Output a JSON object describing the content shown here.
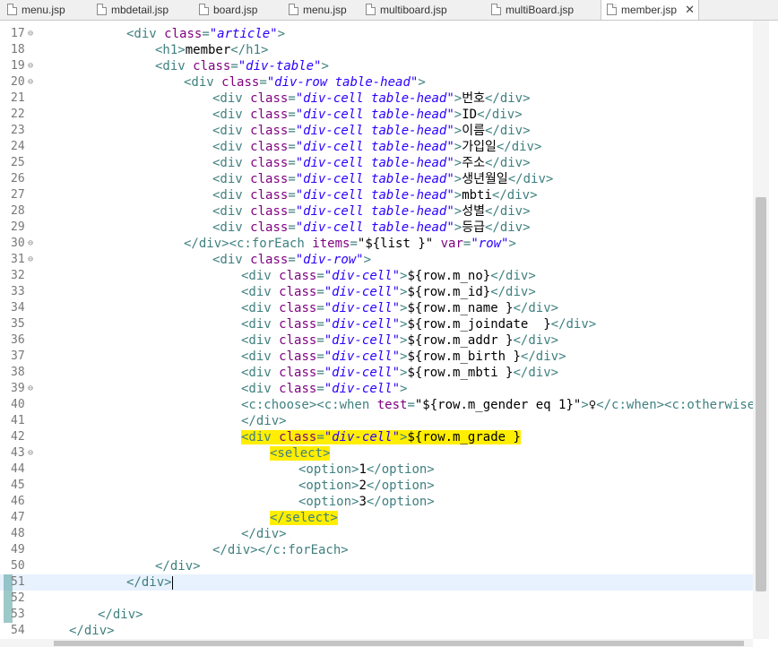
{
  "tabs": [
    {
      "label": "menu.jsp",
      "active": false
    },
    {
      "label": "mbdetail.jsp",
      "active": false
    },
    {
      "label": "board.jsp",
      "active": false
    },
    {
      "label": "menu.jsp",
      "active": false
    },
    {
      "label": "multiboard.jsp",
      "active": false
    },
    {
      "label": "multiBoard.jsp",
      "active": false
    },
    {
      "label": "member.jsp",
      "active": true
    }
  ],
  "close_icon": "✕",
  "fold_icon": "⊖",
  "colors": {
    "tag": "#3f7f7f",
    "attribute": "#7f007f",
    "value": "#2a00ff",
    "highlight": "#ffee00"
  },
  "lines": [
    {
      "n": "17",
      "fold": true,
      "segs": [
        [
          "t",
          "<div "
        ],
        [
          "a",
          "class"
        ],
        [
          "t",
          "="
        ],
        [
          "v",
          "\"article\""
        ],
        [
          "t",
          ">"
        ]
      ]
    },
    {
      "n": "18",
      "segs": [
        [
          "t",
          "<h1>"
        ],
        [
          "x",
          "member"
        ],
        [
          "t",
          "</h1>"
        ]
      ]
    },
    {
      "n": "19",
      "fold": true,
      "segs": [
        [
          "t",
          "<div "
        ],
        [
          "a",
          "class"
        ],
        [
          "t",
          "="
        ],
        [
          "v",
          "\"div-table\""
        ],
        [
          "t",
          ">"
        ]
      ]
    },
    {
      "n": "20",
      "fold": true,
      "segs": [
        [
          "t",
          "<div "
        ],
        [
          "a",
          "class"
        ],
        [
          "t",
          "="
        ],
        [
          "v",
          "\"div-row table-head\""
        ],
        [
          "t",
          ">"
        ]
      ]
    },
    {
      "n": "21",
      "segs": [
        [
          "t",
          "<div "
        ],
        [
          "a",
          "class"
        ],
        [
          "t",
          "="
        ],
        [
          "v",
          "\"div-cell table-head\""
        ],
        [
          "t",
          ">"
        ],
        [
          "x",
          "번호"
        ],
        [
          "t",
          "</div>"
        ]
      ]
    },
    {
      "n": "22",
      "segs": [
        [
          "t",
          "<div "
        ],
        [
          "a",
          "class"
        ],
        [
          "t",
          "="
        ],
        [
          "v",
          "\"div-cell table-head\""
        ],
        [
          "t",
          ">"
        ],
        [
          "x",
          "ID"
        ],
        [
          "t",
          "</div>"
        ]
      ]
    },
    {
      "n": "23",
      "segs": [
        [
          "t",
          "<div "
        ],
        [
          "a",
          "class"
        ],
        [
          "t",
          "="
        ],
        [
          "v",
          "\"div-cell table-head\""
        ],
        [
          "t",
          ">"
        ],
        [
          "x",
          "이름"
        ],
        [
          "t",
          "</div>"
        ]
      ]
    },
    {
      "n": "24",
      "segs": [
        [
          "t",
          "<div "
        ],
        [
          "a",
          "class"
        ],
        [
          "t",
          "="
        ],
        [
          "v",
          "\"div-cell table-head\""
        ],
        [
          "t",
          ">"
        ],
        [
          "x",
          "가입일"
        ],
        [
          "t",
          "</div>"
        ]
      ]
    },
    {
      "n": "25",
      "segs": [
        [
          "t",
          "<div "
        ],
        [
          "a",
          "class"
        ],
        [
          "t",
          "="
        ],
        [
          "v",
          "\"div-cell table-head\""
        ],
        [
          "t",
          ">"
        ],
        [
          "x",
          "주소"
        ],
        [
          "t",
          "</div>"
        ]
      ]
    },
    {
      "n": "26",
      "segs": [
        [
          "t",
          "<div "
        ],
        [
          "a",
          "class"
        ],
        [
          "t",
          "="
        ],
        [
          "v",
          "\"div-cell table-head\""
        ],
        [
          "t",
          ">"
        ],
        [
          "x",
          "생년월일"
        ],
        [
          "t",
          "</div>"
        ]
      ]
    },
    {
      "n": "27",
      "segs": [
        [
          "t",
          "<div "
        ],
        [
          "a",
          "class"
        ],
        [
          "t",
          "="
        ],
        [
          "v",
          "\"div-cell table-head\""
        ],
        [
          "t",
          ">"
        ],
        [
          "x",
          "mbti"
        ],
        [
          "t",
          "</div>"
        ]
      ]
    },
    {
      "n": "28",
      "segs": [
        [
          "t",
          "<div "
        ],
        [
          "a",
          "class"
        ],
        [
          "t",
          "="
        ],
        [
          "v",
          "\"div-cell table-head\""
        ],
        [
          "t",
          ">"
        ],
        [
          "x",
          "성별"
        ],
        [
          "t",
          "</div>"
        ]
      ]
    },
    {
      "n": "29",
      "segs": [
        [
          "t",
          "<div "
        ],
        [
          "a",
          "class"
        ],
        [
          "t",
          "="
        ],
        [
          "v",
          "\"div-cell table-head\""
        ],
        [
          "t",
          ">"
        ],
        [
          "x",
          "등급"
        ],
        [
          "t",
          "</div>"
        ]
      ]
    },
    {
      "n": "30",
      "fold": true,
      "segs": [
        [
          "t",
          "</div><c:forEach "
        ],
        [
          "a",
          "items"
        ],
        [
          "t",
          "="
        ],
        [
          "x",
          "\"${list }\" "
        ],
        [
          "a",
          "var"
        ],
        [
          "t",
          "="
        ],
        [
          "v",
          "\"row\""
        ],
        [
          "t",
          ">"
        ]
      ]
    },
    {
      "n": "31",
      "fold": true,
      "segs": [
        [
          "t",
          "<div "
        ],
        [
          "a",
          "class"
        ],
        [
          "t",
          "="
        ],
        [
          "v",
          "\"div-row\""
        ],
        [
          "t",
          ">"
        ]
      ]
    },
    {
      "n": "32",
      "segs": [
        [
          "t",
          "<div "
        ],
        [
          "a",
          "class"
        ],
        [
          "t",
          "="
        ],
        [
          "v",
          "\"div-cell\""
        ],
        [
          "t",
          ">"
        ],
        [
          "x",
          "${row.m_no}"
        ],
        [
          "t",
          "</div>"
        ]
      ]
    },
    {
      "n": "33",
      "segs": [
        [
          "t",
          "<div "
        ],
        [
          "a",
          "class"
        ],
        [
          "t",
          "="
        ],
        [
          "v",
          "\"div-cell\""
        ],
        [
          "t",
          ">"
        ],
        [
          "x",
          "${row.m_id}"
        ],
        [
          "t",
          "</div>"
        ]
      ]
    },
    {
      "n": "34",
      "segs": [
        [
          "t",
          "<div "
        ],
        [
          "a",
          "class"
        ],
        [
          "t",
          "="
        ],
        [
          "v",
          "\"div-cell\""
        ],
        [
          "t",
          ">"
        ],
        [
          "x",
          "${row.m_name }"
        ],
        [
          "t",
          "</div>"
        ]
      ]
    },
    {
      "n": "35",
      "segs": [
        [
          "t",
          "<div "
        ],
        [
          "a",
          "class"
        ],
        [
          "t",
          "="
        ],
        [
          "v",
          "\"div-cell\""
        ],
        [
          "t",
          ">"
        ],
        [
          "x",
          "${row.m_joindate  }"
        ],
        [
          "t",
          "</div>"
        ]
      ]
    },
    {
      "n": "36",
      "segs": [
        [
          "t",
          "<div "
        ],
        [
          "a",
          "class"
        ],
        [
          "t",
          "="
        ],
        [
          "v",
          "\"div-cell\""
        ],
        [
          "t",
          ">"
        ],
        [
          "x",
          "${row.m_addr }"
        ],
        [
          "t",
          "</div>"
        ]
      ]
    },
    {
      "n": "37",
      "segs": [
        [
          "t",
          "<div "
        ],
        [
          "a",
          "class"
        ],
        [
          "t",
          "="
        ],
        [
          "v",
          "\"div-cell\""
        ],
        [
          "t",
          ">"
        ],
        [
          "x",
          "${row.m_birth }"
        ],
        [
          "t",
          "</div>"
        ]
      ]
    },
    {
      "n": "38",
      "segs": [
        [
          "t",
          "<div "
        ],
        [
          "a",
          "class"
        ],
        [
          "t",
          "="
        ],
        [
          "v",
          "\"div-cell\""
        ],
        [
          "t",
          ">"
        ],
        [
          "x",
          "${row.m_mbti }"
        ],
        [
          "t",
          "</div>"
        ]
      ]
    },
    {
      "n": "39",
      "fold": true,
      "segs": [
        [
          "t",
          "<div "
        ],
        [
          "a",
          "class"
        ],
        [
          "t",
          "="
        ],
        [
          "v",
          "\"div-cell\""
        ],
        [
          "t",
          ">"
        ]
      ]
    },
    {
      "n": "40",
      "segs": [
        [
          "t",
          "<c:choose><c:when "
        ],
        [
          "a",
          "test"
        ],
        [
          "t",
          "="
        ],
        [
          "x",
          "\"${row.m_gender eq 1}\""
        ],
        [
          "t",
          ">"
        ],
        [
          "x",
          "♀"
        ],
        [
          "t",
          "</c:when><c:otherwise>"
        ],
        [
          "x",
          "♂"
        ],
        [
          "t",
          "</"
        ]
      ]
    },
    {
      "n": "41",
      "segs": [
        [
          "t",
          "</div>"
        ]
      ]
    },
    {
      "n": "42",
      "hl": true,
      "segs": [
        [
          "t",
          "<div "
        ],
        [
          "a",
          "class"
        ],
        [
          "t",
          "="
        ],
        [
          "v",
          "\"div-cell\""
        ],
        [
          "t",
          ">"
        ],
        [
          "x",
          "${row.m_grade }"
        ]
      ]
    },
    {
      "n": "43",
      "fold": true,
      "hl": true,
      "segs": [
        [
          "t",
          "<select>"
        ]
      ]
    },
    {
      "n": "44",
      "segs": [
        [
          "t",
          "<option>"
        ],
        [
          "x",
          "1"
        ],
        [
          "t",
          "</option>"
        ]
      ]
    },
    {
      "n": "45",
      "segs": [
        [
          "t",
          "<option>"
        ],
        [
          "x",
          "2"
        ],
        [
          "t",
          "</option>"
        ]
      ]
    },
    {
      "n": "46",
      "segs": [
        [
          "t",
          "<option>"
        ],
        [
          "x",
          "3"
        ],
        [
          "t",
          "</option>"
        ]
      ]
    },
    {
      "n": "47",
      "hl": true,
      "segs": [
        [
          "t",
          "</select>"
        ]
      ]
    },
    {
      "n": "48",
      "segs": [
        [
          "t",
          "</div>"
        ]
      ]
    },
    {
      "n": "49",
      "segs": [
        [
          "t",
          "</div></c:forEach>"
        ]
      ]
    },
    {
      "n": "50",
      "segs": [
        [
          "t",
          "</div>"
        ]
      ]
    },
    {
      "n": "51",
      "current": true,
      "segs": [
        [
          "t",
          "</div>"
        ]
      ]
    },
    {
      "n": "52",
      "segs": []
    },
    {
      "n": "53",
      "segs": [
        [
          "t",
          "</div>"
        ]
      ]
    },
    {
      "n": "54",
      "segs": [
        [
          "t",
          "</div>"
        ]
      ]
    }
  ]
}
